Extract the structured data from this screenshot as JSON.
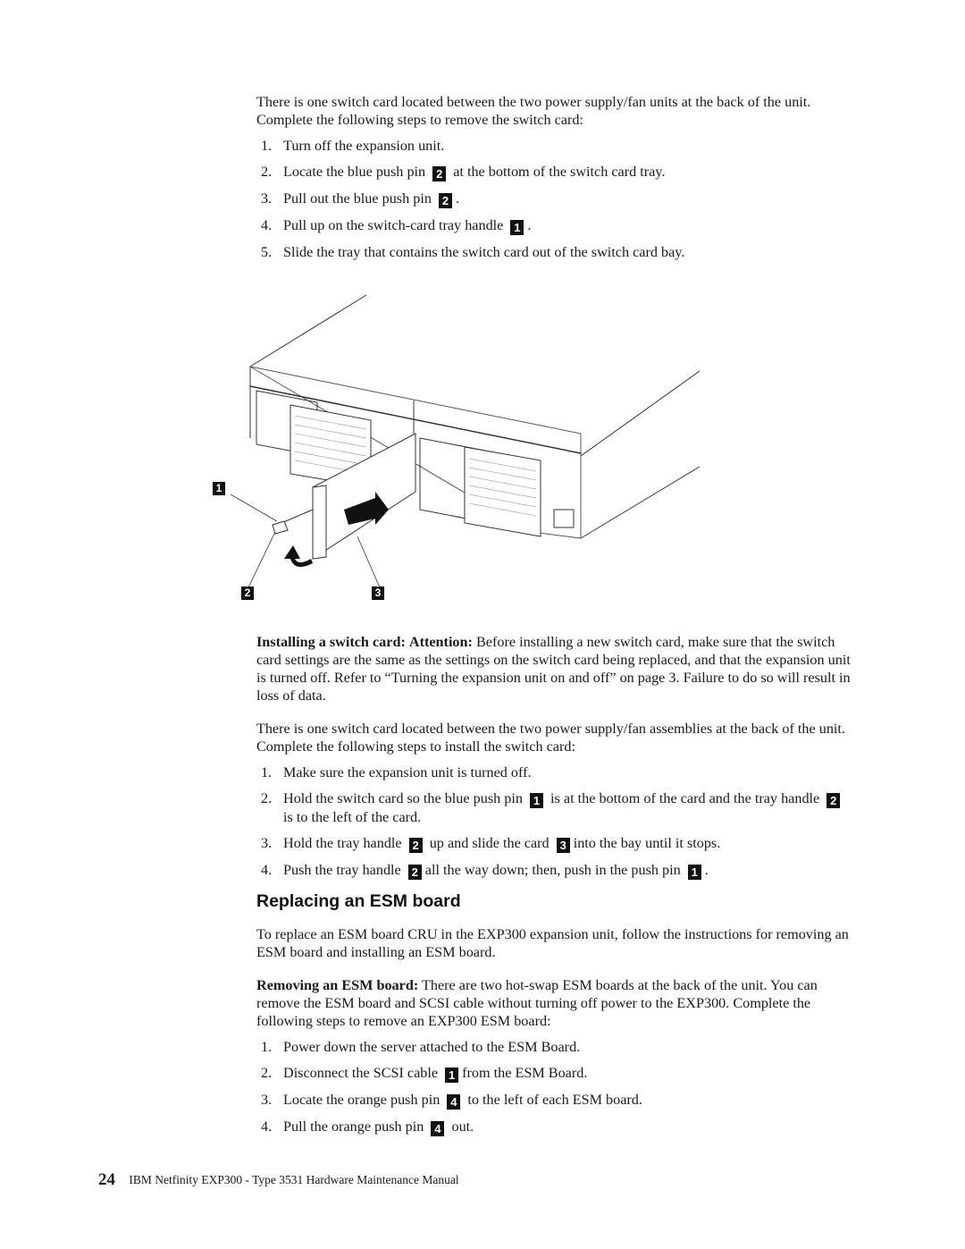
{
  "section1": {
    "intro": "There is one switch card located between the two power supply/fan units at the back of the unit.  Complete the following steps to remove the switch card:",
    "steps": [
      {
        "num": "1.",
        "pre": "Turn off the expansion unit.",
        "callout": "",
        "post": ""
      },
      {
        "num": "2.",
        "pre": "Locate the blue push pin",
        "callout": "2",
        "post": "at the bottom of the switch card tray."
      },
      {
        "num": "3.",
        "pre": "Pull out the blue push pin",
        "callout": "2",
        "post": "."
      },
      {
        "num": "4.",
        "pre": "Pull up on the switch-card tray handle",
        "callout": "1",
        "post": "."
      },
      {
        "num": "5.",
        "pre": "Slide the tray that contains the switch card out of the switch card bay.",
        "callout": "",
        "post": ""
      }
    ]
  },
  "figure": {
    "description": "Rear view of expansion unit with switch card tray being slid out",
    "callouts": [
      "1",
      "2",
      "3"
    ]
  },
  "section2": {
    "lead_bold": "Installing a switch card:",
    "attention_bold": "Attention:",
    "attention_text": "Before installing a new switch card, make sure that the switch card settings are the same as the settings on the switch card being replaced, and that the expansion unit is turned off. Refer to “Turning the expansion unit on and off” on page 3.  Failure to do so will result in loss of data.",
    "intro": "There is one switch card located between the two power supply/fan assemblies at the back of the unit.  Complete the following steps to install the switch card:",
    "steps": [
      {
        "num": "1.",
        "parts": [
          "Make sure the expansion unit is turned off."
        ],
        "callouts": []
      },
      {
        "num": "2.",
        "parts": [
          "Hold the switch card so the blue push pin",
          "is at the bottom of the card and the tray handle",
          "is to the left of the card."
        ],
        "callouts": [
          "1",
          "2"
        ]
      },
      {
        "num": "3.",
        "parts": [
          "Hold the tray handle",
          "up and slide the card",
          "into the bay until it stops."
        ],
        "callouts": [
          "2",
          "3"
        ]
      },
      {
        "num": "4.",
        "parts": [
          "Push the tray handle",
          "all the way down; then, push in the push pin",
          "."
        ],
        "callouts": [
          "2",
          "1"
        ]
      }
    ]
  },
  "section3": {
    "heading": "Replacing an ESM board",
    "intro": "To replace an ESM board CRU in the EXP300 expansion unit, follow the instructions for removing an ESM board and installing an ESM board.",
    "lead_bold": "Removing an ESM board:",
    "lead_text": "There are two hot-swap ESM boards at the back of the unit.  You can remove the ESM board and SCSI cable without turning off power to the EXP300. Complete the following steps to remove an EXP300 ESM board:",
    "steps": [
      {
        "num": "1.",
        "pre": "Power down the server attached to the ESM Board.",
        "callout": "",
        "post": ""
      },
      {
        "num": "2.",
        "pre": "Disconnect the SCSI cable",
        "callout": "1",
        "post": "from the ESM Board."
      },
      {
        "num": "3.",
        "pre": "Locate the orange push pin",
        "callout": "4",
        "post": "to the left of each ESM board."
      },
      {
        "num": "4.",
        "pre": "Pull the orange push pin",
        "callout": "4",
        "post": "out."
      }
    ]
  },
  "footer": {
    "page_number": "24",
    "title": "IBM Netfinity EXP300 - Type 3531 Hardware Maintenance Manual"
  }
}
